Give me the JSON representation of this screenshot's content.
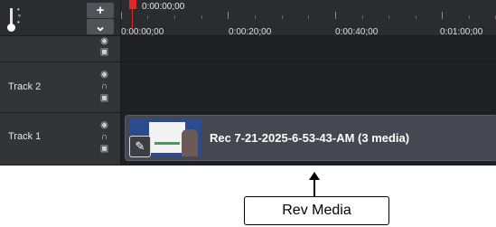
{
  "timeline": {
    "playhead_time": "0:00:00;00",
    "ruler_labels": [
      "0:00:00;00",
      "0:00:20;00",
      "0:00:40;00",
      "0:01:00;00"
    ],
    "add_track_label": "+",
    "collapse_label": "⌄",
    "accent_color": "#e02828"
  },
  "tracks": [
    {
      "label": ""
    },
    {
      "label": "Track 2"
    },
    {
      "label": "Track 1"
    }
  ],
  "clip": {
    "title": "Rec 7-21-2025-6-53-43-AM  (3 media)",
    "edit_icon": "pencil-icon"
  },
  "callout": {
    "label": "Rev Media"
  }
}
